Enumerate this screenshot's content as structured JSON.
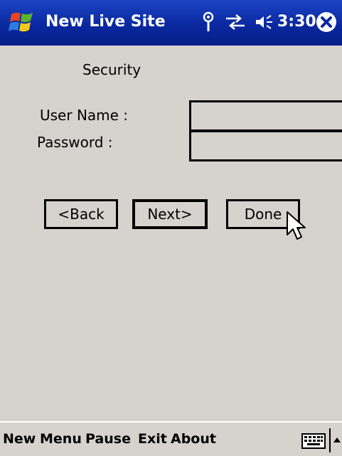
{
  "titlebar": {
    "title": "New Live Site",
    "time": "3:30",
    "icons": [
      "windows-flag-icon",
      "antenna-icon",
      "sync-arrows-icon",
      "volume-icon",
      "close-icon"
    ]
  },
  "form": {
    "heading": "Security",
    "username_label": "User Name :",
    "username_value": "",
    "password_label": "Password :",
    "password_value": ""
  },
  "buttons": {
    "back": "<Back",
    "next": "Next>",
    "done": "Done"
  },
  "menubar": {
    "new": "New",
    "menu": "Menu",
    "pause": "Pause",
    "exit": "Exit",
    "about": "About",
    "icons": [
      "keyboard-icon",
      "sip-up-arrow-icon"
    ]
  },
  "colors": {
    "titlebar": "#0a28a0",
    "background": "#d6d3ce",
    "text": "#000000"
  }
}
